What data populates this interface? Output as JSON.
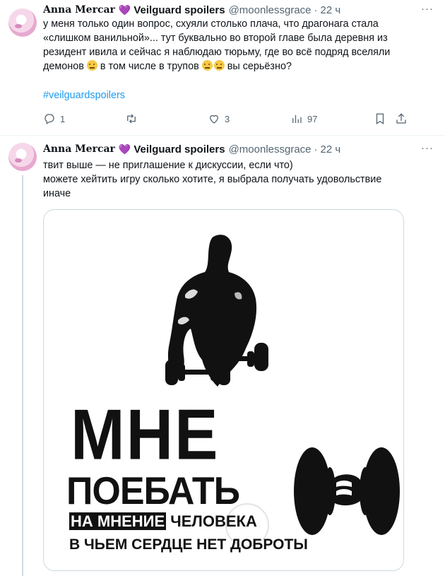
{
  "tweets": [
    {
      "author_name": "Anna Mercar",
      "author_emoji": "💜",
      "author_badge": "Veilguard spoilers",
      "handle": "@moonlessgrace",
      "separator": "·",
      "time": "22 ч",
      "text_lines": [
        "у меня только один вопрос, схуяли столько плача, что драгонага стала",
        "«слишком ванильной»... тут буквально во второй главе была деревня из",
        "резидент ивила и сейчас я наблюдаю тюрьму, где во всё подряд вселяли",
        "демонов",
        "в том числе в трупов",
        "вы серьёзно?"
      ],
      "hashtag": "#veilguardspoilers",
      "actions": {
        "replies": "1",
        "retweets": "",
        "likes": "3",
        "views": "97"
      }
    },
    {
      "author_name": "Anna Mercar",
      "author_emoji": "💜",
      "author_badge": "Veilguard spoilers",
      "handle": "@moonlessgrace",
      "separator": "·",
      "time": "22 ч",
      "text_lines": [
        "твит выше — не приглашение к дискуссии, если что)",
        "можете хейтить игру сколько хотите, я выбрала получать удовольствие",
        "иначе"
      ],
      "image": {
        "line1": "МНЕ",
        "line2": "ПОЕБАТЬ",
        "line3_highlight": "НА МНЕНИЕ",
        "line3_rest": "ЧЕЛОВЕКА",
        "line4": "В ЧЬЕМ СЕРДЦЕ НЕТ ДОБРОТЫ"
      }
    }
  ],
  "ui": {
    "more_label": "···",
    "accent_color": "#1d9bf0",
    "muted_color": "#536471",
    "icons": [
      "reply-icon",
      "retweet-icon",
      "like-icon",
      "views-icon",
      "bookmark-icon",
      "share-icon",
      "more-icon",
      "emoji-raised-eyebrow-icon",
      "purple-heart-icon"
    ]
  }
}
